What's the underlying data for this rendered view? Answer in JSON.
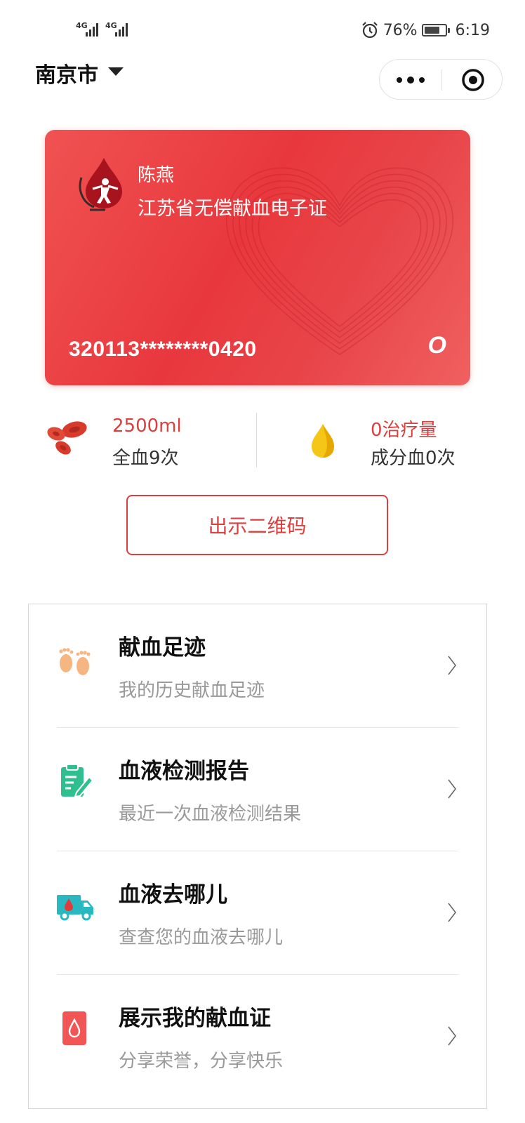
{
  "status_bar": {
    "network_1": "4G",
    "network_2": "4G",
    "battery_percent": "76%",
    "battery_level": 0.76,
    "time": "6:19"
  },
  "header": {
    "city": "南京市",
    "capsule_icons": [
      "more-icon",
      "target-icon"
    ]
  },
  "card": {
    "name": "陈燕",
    "cert_title": "江苏省无偿献血电子证",
    "id_number": "320113********0420",
    "blood_type": "O",
    "colors": {
      "card_bg": "#e8383d",
      "card_text": "#ffffff"
    }
  },
  "stats": {
    "whole_blood": {
      "value": "2500ml",
      "label": "全血9次",
      "icon": "red-blood-cells-icon"
    },
    "components": {
      "value": "0治疗量",
      "label": "成分血0次",
      "icon": "plasma-drop-icon"
    }
  },
  "qr_button": {
    "label": "出示二维码"
  },
  "menu": {
    "items": [
      {
        "title": "献血足迹",
        "subtitle": "我的历史献血足迹",
        "icon": "footprints-icon"
      },
      {
        "title": "血液检测报告",
        "subtitle": "最近一次血液检测结果",
        "icon": "report-icon"
      },
      {
        "title": "血液去哪儿",
        "subtitle": "查查您的血液去哪儿",
        "icon": "ambulance-icon"
      },
      {
        "title": "展示我的献血证",
        "subtitle": "分享荣誉，分享快乐",
        "icon": "blood-certificate-icon"
      }
    ]
  },
  "colors": {
    "accent": "#d9403f",
    "muted_text": "#999999"
  }
}
